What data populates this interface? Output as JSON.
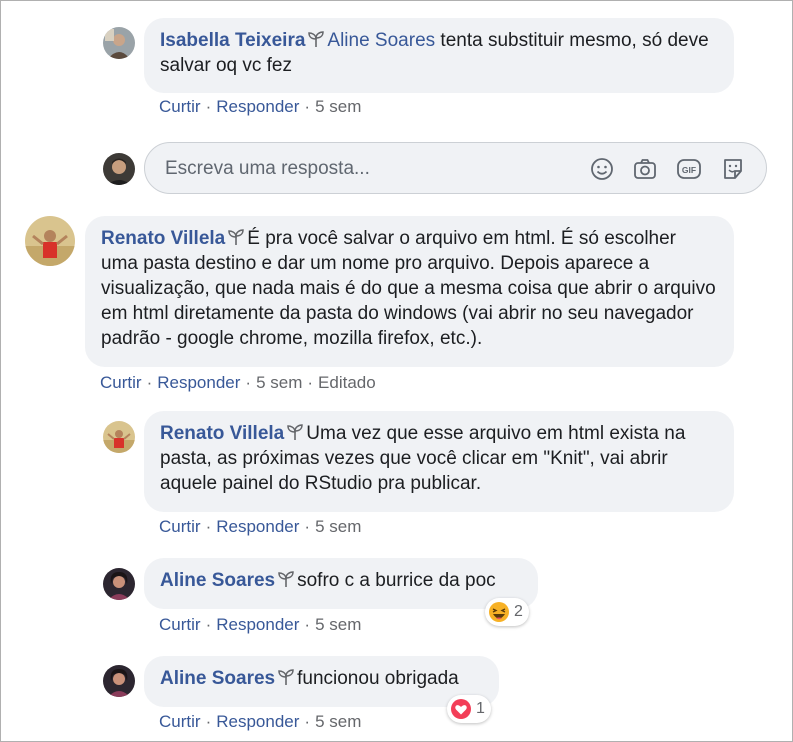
{
  "comments": [
    {
      "author": "Isabella Teixeira",
      "mention": "Aline Soares",
      "text": " tenta substituir mesmo, só deve salvar oq vc fez",
      "actions": {
        "like": "Curtir",
        "reply": "Responder",
        "time": "5 sem"
      }
    },
    {
      "author": "Renato Villela",
      "text": "É pra você salvar o arquivo em html. É só escolher uma pasta destino e dar um nome pro arquivo. Depois aparece a visualização, que nada mais é do que a mesma coisa que abrir o arquivo em html diretamente da pasta do windows (vai abrir no seu navegador padrão - google chrome, mozilla firefox, etc.).",
      "actions": {
        "like": "Curtir",
        "reply": "Responder",
        "time": "5 sem",
        "edited": "Editado"
      }
    },
    {
      "author": "Renato Villela",
      "text": "Uma vez que esse arquivo em html exista na pasta, as próximas vezes que você clicar em \"Knit\", vai abrir aquele painel do RStudio pra publicar.",
      "actions": {
        "like": "Curtir",
        "reply": "Responder",
        "time": "5 sem"
      }
    },
    {
      "author": "Aline Soares",
      "text": "sofro c a burrice da poc",
      "actions": {
        "like": "Curtir",
        "reply": "Responder",
        "time": "5 sem"
      },
      "reaction": {
        "icon": "haha-emoji-icon",
        "count": "2"
      }
    },
    {
      "author": "Aline Soares",
      "text": "funcionou obrigada",
      "actions": {
        "like": "Curtir",
        "reply": "Responder",
        "time": "5 sem"
      },
      "reaction": {
        "icon": "love-heart-icon",
        "count": "1"
      }
    }
  ],
  "reply_box": {
    "placeholder": "Escreva uma resposta...",
    "icons": [
      "emoji-icon",
      "camera-icon",
      "gif-icon",
      "sticker-icon"
    ]
  },
  "colors": {
    "link": "#385898",
    "bubble": "#f0f2f5",
    "muted": "#65676b",
    "love": "#f33e58",
    "haha": "#f7b125"
  }
}
